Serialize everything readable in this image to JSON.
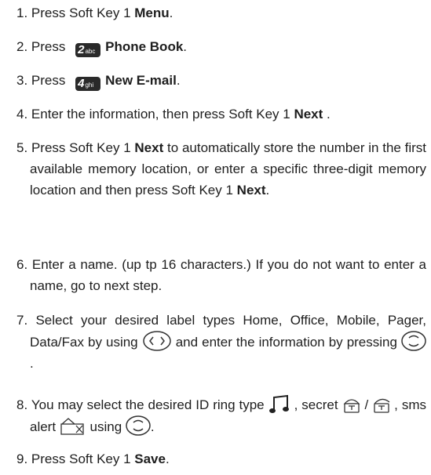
{
  "steps": [
    {
      "num": "1.",
      "pre": "Press Soft Key 1 ",
      "bold": "Menu",
      "post": "."
    },
    {
      "num": "2.",
      "pre": "Press ",
      "key_num": "2",
      "key_sub": "abc",
      "bold": "Phone Book",
      "post": "."
    },
    {
      "num": "3.",
      "pre": "Press ",
      "key_num": "4",
      "key_sub": "ghi",
      "bold": "New E-mail",
      "post": "."
    },
    {
      "num": "4.",
      "pre": "Enter the information, then press Soft Key 1 ",
      "bold": "Next",
      "post": " ."
    },
    {
      "num": "5.",
      "pre": "Press Soft Key 1 ",
      "bold": "Next",
      "mid": " to automatically store the number in the first available memory location, or enter a specific three-digit memory location and  then press Soft Key 1 ",
      "bold2": "Next",
      "post": "."
    },
    {
      "num": "6.",
      "text": "Enter a name. (up tp 16 characters.) If you do not want to  enter a name, go to next step."
    },
    {
      "num": "7.",
      "pre": "Select your desired label types Home, Office, Mobile, Pager, Data/Fax by using ",
      "mid": " and enter the information by pressing ",
      "post": " ."
    },
    {
      "num": "8.",
      "pre": "You may select the desired ID ring type ",
      "mid1": " , secret ",
      "slash": " / ",
      "mid2": ", sms alert ",
      "mid3": " using ",
      "post": "."
    },
    {
      "num": "9.",
      "pre": "Press Soft Key 1 ",
      "bold": "Save",
      "post": "."
    }
  ],
  "icons": {
    "lr_nav": "left-right-nav-key-icon",
    "ud_nav": "up-down-nav-key-icon",
    "ring": "ring-type-music-note-icon",
    "lock_closed": "lock-closed-icon",
    "lock_open": "lock-open-icon",
    "sms": "sms-alert-envelope-icon"
  }
}
